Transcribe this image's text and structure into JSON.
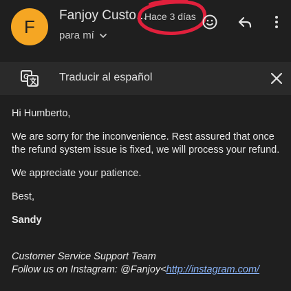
{
  "header": {
    "avatar_letter": "F",
    "sender": "Fanjoy Custo...",
    "timestamp": "Hace 3 días",
    "recipient": "para mí",
    "colors": {
      "avatar": "#f5a623",
      "annotation": "#e0203c"
    },
    "icons": [
      "emoji-icon",
      "reply-icon",
      "more-vert-icon",
      "chevron-down-icon"
    ]
  },
  "translate_bar": {
    "label": "Traducir al español",
    "icons": [
      "translate-icon",
      "close-icon"
    ]
  },
  "email": {
    "greeting": "Hi Humberto,",
    "paragraph1": "We are sorry for the inconvenience. Rest assured that once the refund system issue is fixed, we will process your refund.",
    "paragraph2": "We appreciate your patience.",
    "closing": "Best,",
    "signature": "Sandy",
    "team": "Customer Service Support Team",
    "follow_prefix": "Follow us on Instagram: @Fanjoy<",
    "follow_link": "http://instagram.com/"
  }
}
